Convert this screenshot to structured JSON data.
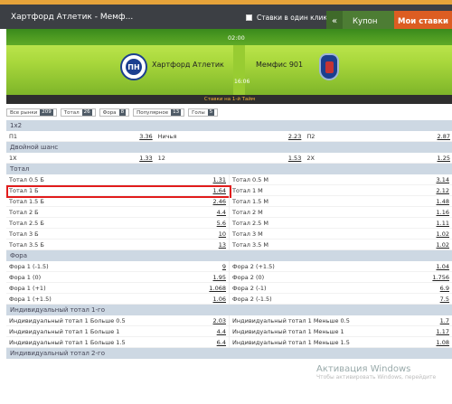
{
  "header": {
    "title": "Хартфорд Атлетик - Мемф...",
    "one_click": "Ставки в один клик",
    "coupon": "Купон",
    "my_bets": "Мои ставки"
  },
  "banner": {
    "time": "02:00",
    "score": "16:06",
    "team1": "Хартфорд Атлетик",
    "team1_logo_text": "ΠΗ",
    "team2": "Мемфис 901",
    "footer": "Ставки на 1-й Тайм"
  },
  "filters": [
    {
      "label": "Все рынки",
      "count": "209"
    },
    {
      "label": "Тотал",
      "count": "26"
    },
    {
      "label": "Фора",
      "count": "8"
    },
    {
      "label": "Популярное",
      "count": "13"
    },
    {
      "label": "Голы",
      "count": "5"
    }
  ],
  "sections": [
    {
      "title": "1x2",
      "rows3": [
        {
          "l1": "П1",
          "o1": "3.36",
          "l2": "Ничья",
          "o2": "2.23",
          "l3": "П2",
          "o3": "2.87"
        }
      ]
    },
    {
      "title": "Двойной шанс",
      "rows3": [
        {
          "l1": "1X",
          "o1": "1.33",
          "l2": "12",
          "o2": "1.53",
          "l3": "2X",
          "o3": "1.25"
        }
      ]
    },
    {
      "title": "Тотал",
      "rows": [
        {
          "l1": "Тотал 0.5 Б",
          "o1": "1.31",
          "l2": "Тотал 0.5 М",
          "o2": "3.14"
        },
        {
          "l1": "Тотал 1 Б",
          "o1": "1.64",
          "l2": "Тотал 1 М",
          "o2": "2.12"
        },
        {
          "l1": "Тотал 1.5 Б",
          "o1": "2.46",
          "l2": "Тотал 1.5 М",
          "o2": "1.48"
        },
        {
          "l1": "Тотал 2 Б",
          "o1": "4.4",
          "l2": "Тотал 2 М",
          "o2": "1.16"
        },
        {
          "l1": "Тотал 2.5 Б",
          "o1": "5.6",
          "l2": "Тотал 2.5 М",
          "o2": "1.11"
        },
        {
          "l1": "Тотал 3 Б",
          "o1": "10",
          "l2": "Тотал 3 М",
          "o2": "1.02"
        },
        {
          "l1": "Тотал 3.5 Б",
          "o1": "13",
          "l2": "Тотал 3.5 М",
          "o2": "1.02"
        }
      ]
    },
    {
      "title": "Фора",
      "rows": [
        {
          "l1": "Фора 1 (-1.5)",
          "o1": "9",
          "l2": "Фора 2 (+1.5)",
          "o2": "1.04"
        },
        {
          "l1": "Фора 1 (0)",
          "o1": "1.95",
          "l2": "Фора 2 (0)",
          "o2": "1.756"
        },
        {
          "l1": "Фора 1 (+1)",
          "o1": "1.068",
          "l2": "Фора 2 (-1)",
          "o2": "6.9"
        },
        {
          "l1": "Фора 1 (+1.5)",
          "o1": "1.06",
          "l2": "Фора 2 (-1.5)",
          "o2": "7.5"
        }
      ]
    },
    {
      "title": "Индивидуальный тотал 1-го",
      "rows": [
        {
          "l1": "Индивидуальный тотал 1 Больше 0.5",
          "o1": "2.03",
          "l2": "Индивидуальный тотал 1 Меньше 0.5",
          "o2": "1.7"
        },
        {
          "l1": "Индивидуальный тотал 1 Больше 1",
          "o1": "4.4",
          "l2": "Индивидуальный тотал 1 Меньше 1",
          "o2": "1.17"
        },
        {
          "l1": "Индивидуальный тотал 1 Больше 1.5",
          "o1": "6.4",
          "l2": "Индивидуальный тотал 1 Меньше 1.5",
          "o2": "1.08"
        }
      ]
    },
    {
      "title": "Индивидуальный тотал 2-го"
    }
  ],
  "watermark": {
    "title": "Активация Windows",
    "sub": "Чтобы активировать Windows, перейдите"
  }
}
